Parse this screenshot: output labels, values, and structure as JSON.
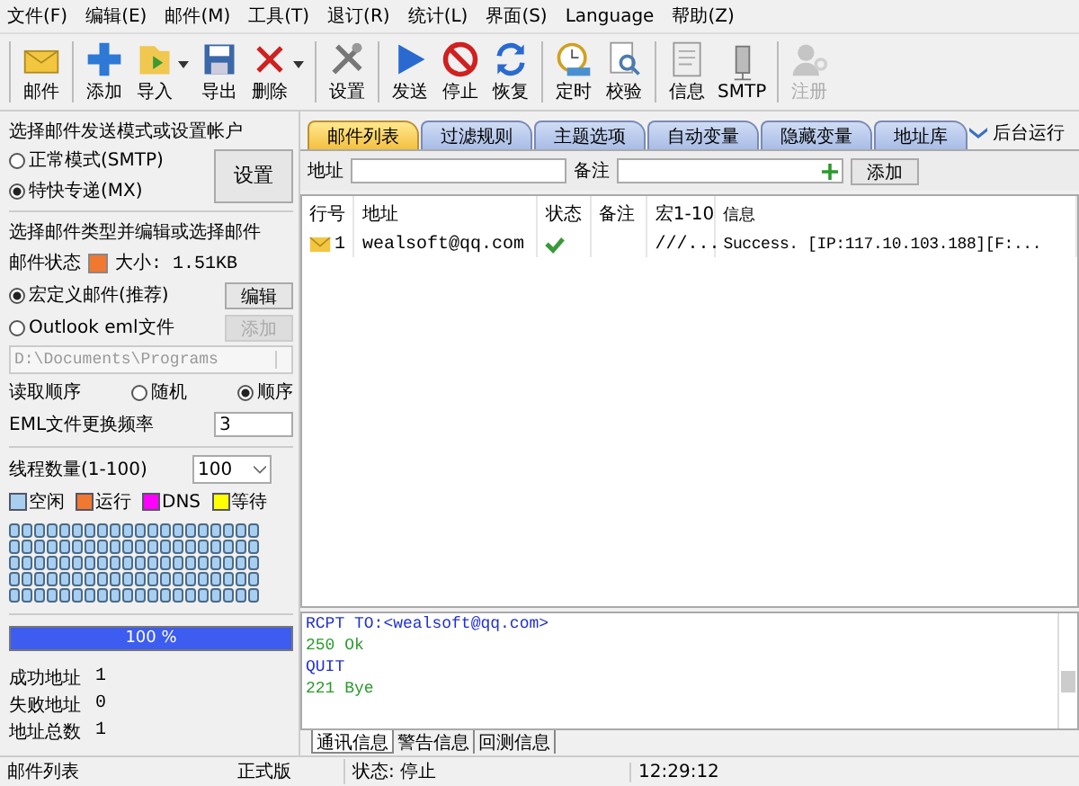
{
  "menu": [
    "文件(F)",
    "编辑(E)",
    "邮件(M)",
    "工具(T)",
    "退订(R)",
    "统计(L)",
    "界面(S)",
    "Language",
    "帮助(Z)"
  ],
  "toolbar": [
    [
      {
        "label": "邮件",
        "dropdown": false,
        "disabled": false
      }
    ],
    [
      {
        "label": "添加",
        "dropdown": false,
        "disabled": false
      },
      {
        "label": "导入",
        "dropdown": true,
        "disabled": false
      },
      {
        "label": "导出",
        "dropdown": false,
        "disabled": false
      },
      {
        "label": "删除",
        "dropdown": true,
        "disabled": false
      }
    ],
    [
      {
        "label": "设置",
        "dropdown": false,
        "disabled": false
      }
    ],
    [
      {
        "label": "发送",
        "dropdown": false,
        "disabled": false
      },
      {
        "label": "停止",
        "dropdown": false,
        "disabled": false
      },
      {
        "label": "恢复",
        "dropdown": false,
        "disabled": false
      }
    ],
    [
      {
        "label": "定时",
        "dropdown": false,
        "disabled": false
      },
      {
        "label": "校验",
        "dropdown": false,
        "disabled": false
      }
    ],
    [
      {
        "label": "信息",
        "dropdown": false,
        "disabled": false
      },
      {
        "label": "SMTP",
        "dropdown": false,
        "disabled": false
      }
    ],
    [
      {
        "label": "注册",
        "dropdown": false,
        "disabled": true
      }
    ]
  ],
  "left": {
    "mode_title": "选择邮件发送模式或设置帐户",
    "modes": [
      {
        "label": "正常模式(SMTP)",
        "selected": false
      },
      {
        "label": "特快专递(MX)",
        "selected": true
      }
    ],
    "settings_button": "设置",
    "type_title": "选择邮件类型并编辑或选择邮件",
    "mail_status": {
      "label": "邮件状态",
      "color": "#f07830"
    },
    "size": "大小: 1.51KB",
    "types": [
      {
        "label": "宏定义邮件(推荐)",
        "selected": true,
        "button": "编辑",
        "button_disabled": false
      },
      {
        "label": "Outlook eml文件",
        "selected": false,
        "button": "添加",
        "button_disabled": true
      }
    ],
    "path": "D:\\Documents\\Programs",
    "order_label": "读取顺序",
    "orders": [
      {
        "label": "随机",
        "selected": false
      },
      {
        "label": "顺序",
        "selected": true
      }
    ],
    "eml_label": "EML文件更换频率",
    "eml_value": "3",
    "threads_label": "线程数量(1-100)",
    "threads_value": "100",
    "legend": [
      {
        "label": "空闲",
        "color": "#a8cff0"
      },
      {
        "label": "运行",
        "color": "#f07830"
      },
      {
        "label": "DNS",
        "color": "#ff00ff"
      },
      {
        "label": "等待",
        "color": "#ffff00"
      }
    ],
    "progress": {
      "level": 1,
      "text": "100 %"
    },
    "stats": [
      {
        "label": "成功地址",
        "value": "1"
      },
      {
        "label": "失败地址",
        "value": "0"
      },
      {
        "label": "地址总数",
        "value": "1"
      }
    ]
  },
  "tabs": [
    {
      "label": "邮件列表",
      "selected": true
    },
    {
      "label": "过滤规则",
      "selected": false
    },
    {
      "label": "主题选项",
      "selected": false
    },
    {
      "label": "自动变量",
      "selected": false
    },
    {
      "label": "隐藏变量",
      "selected": false
    },
    {
      "label": "地址库",
      "selected": false
    }
  ],
  "background_run": "后台运行",
  "address_label": "地址",
  "note_label": "备注",
  "add_button": "添加",
  "table": {
    "columns": [
      "行号",
      "地址",
      "状态",
      "备注",
      "宏1-10",
      "信息"
    ],
    "rows": [
      {
        "line": "1",
        "address": "wealsoft@qq.com",
        "ok": true,
        "note": "",
        "macro": "///...",
        "info": "Success. [IP:117.10.103.188][F:..."
      }
    ]
  },
  "log": [
    {
      "text": "RCPT TO:<wealsoft@qq.com>",
      "kind": "sent"
    },
    {
      "text": "250 Ok",
      "kind": "reply"
    },
    {
      "text": "QUIT",
      "kind": "sent"
    },
    {
      "text": "221 Bye",
      "kind": "reply"
    }
  ],
  "log_tabs": [
    {
      "label": "通讯信息",
      "selected": true
    },
    {
      "label": "警告信息",
      "selected": false
    },
    {
      "label": "回测信息",
      "selected": false
    }
  ],
  "status_bar": [
    "邮件列表",
    "正式版",
    "状态: 停止",
    "12:29:12"
  ]
}
